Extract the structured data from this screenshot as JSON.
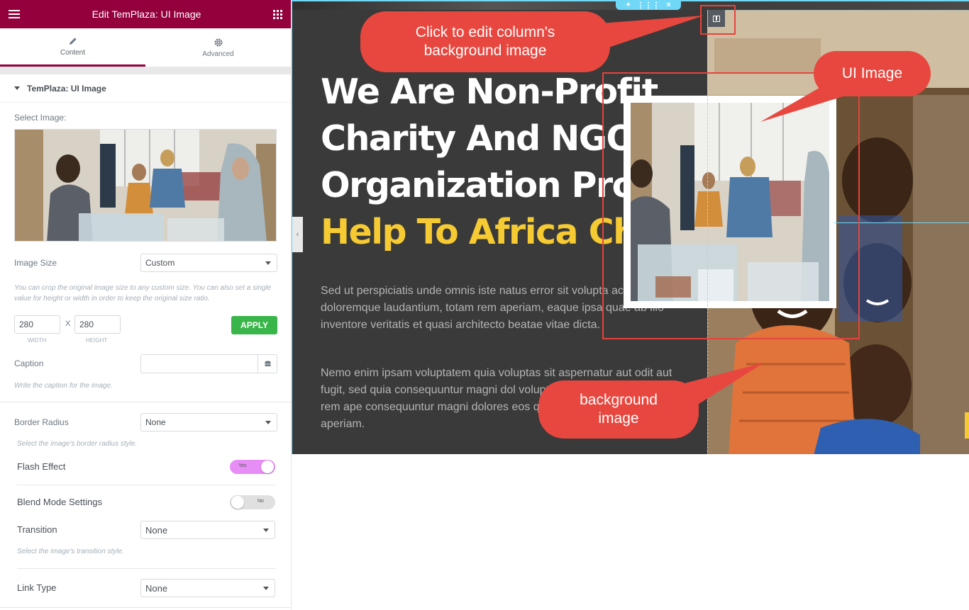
{
  "editor": {
    "title": "Edit TemPlaza: UI Image",
    "tabs": [
      {
        "label": "Content",
        "icon": "pencil-icon",
        "active": true
      },
      {
        "label": "Advanced",
        "icon": "gear-icon",
        "active": false
      }
    ],
    "accent_color": "#93003c"
  },
  "panel": {
    "section_title": "TemPlaza: UI Image",
    "select_image_label": "Select Image:",
    "image_size": {
      "label": "Image Size",
      "value": "Custom",
      "hint": "You can crop the original image size to any custom size. You can also set a single value for height or width in order to keep the original size ratio.",
      "width": "280",
      "height": "280",
      "width_label": "WIDTH",
      "height_label": "HEIGHT",
      "separator": "X",
      "apply": "APPLY"
    },
    "caption": {
      "label": "Caption",
      "value": "",
      "hint": "Write the caption for the image."
    },
    "border_radius": {
      "label": "Border Radius",
      "value": "None",
      "hint": "Select the image's border radius style."
    },
    "flash_effect": {
      "label": "Flash Effect",
      "state": "Yes"
    },
    "blend_mode": {
      "label": "Blend Mode Settings",
      "state": "No"
    },
    "transition": {
      "label": "Transition",
      "value": "None",
      "hint": "Select the image's transition style."
    },
    "link_type": {
      "label": "Link Type",
      "value": "None"
    }
  },
  "preview": {
    "heading_lines": [
      "We Are Non-Profit",
      "Charity And NGO",
      "Organization Provi"
    ],
    "heading_highlight": "Help To Africa Chil",
    "paragraph_1": "Sed ut perspiciatis unde omnis iste natus error sit volupta accusa doloremque laudantium, totam rem aperiam, eaque ipsa quae ab illo inventore veritatis et quasi architecto beatae vitae dicta.",
    "paragraph_2": "Nemo enim ipsam voluptatem quia voluptas sit aspernatur aut odit aut fugit, sed quia consequuntur magni dol voluptatem sequi nesciunt totam rem ape consequuntur magni dolores eos qui ratio nesciunt totam rem aperiam.",
    "section_controls": [
      "+",
      "⋮⋮⋮",
      "×"
    ],
    "highlight_color": "#f6ca33"
  },
  "annotations": {
    "callout_column": "Click to edit column's background image",
    "callout_ui_image": "UI Image",
    "callout_background": "background image",
    "callout_color": "#e8473f"
  }
}
